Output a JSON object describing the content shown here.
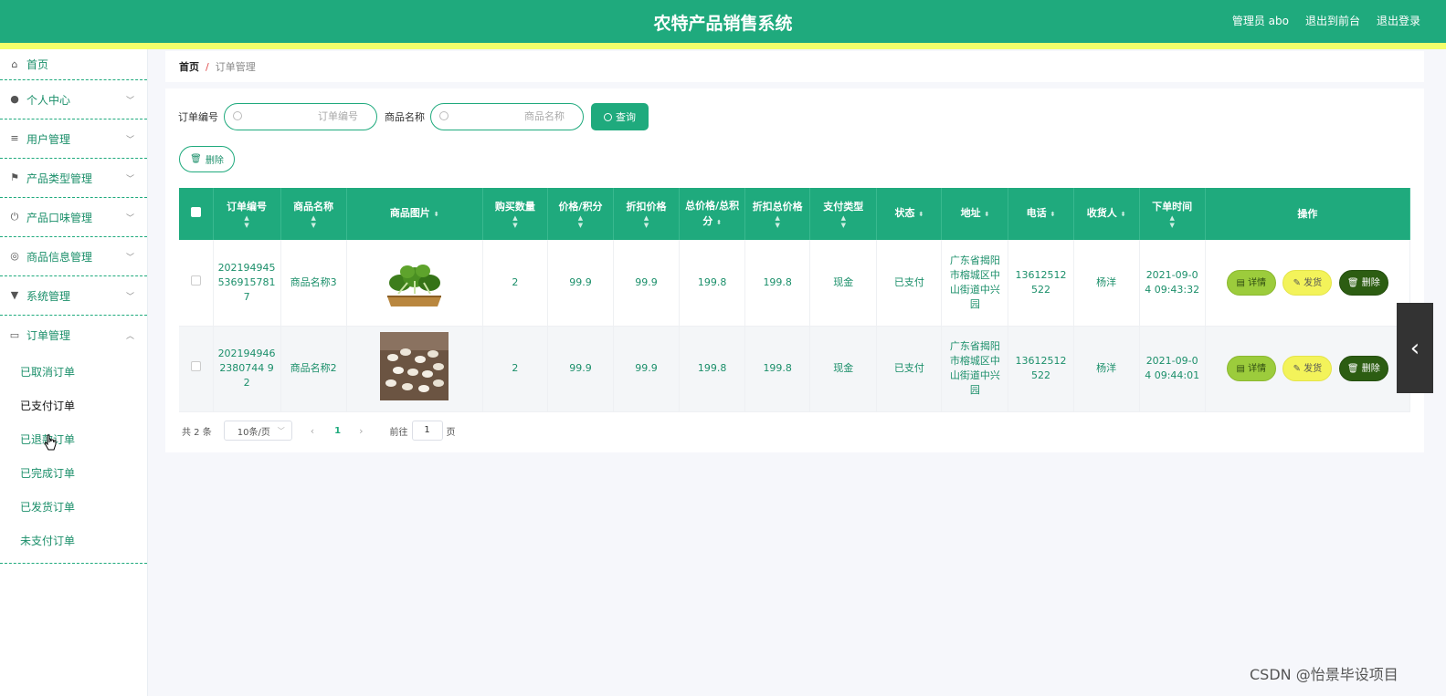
{
  "header": {
    "title": "农特产品销售系统",
    "admin": "管理员 abo",
    "to_front": "退出到前台",
    "logout": "退出登录"
  },
  "sidebar": {
    "items": [
      {
        "label": "首页",
        "icon": "home-icon"
      },
      {
        "label": "个人中心",
        "icon": "user-icon"
      },
      {
        "label": "用户管理",
        "icon": "list-icon"
      },
      {
        "label": "产品类型管理",
        "icon": "flag-icon"
      },
      {
        "label": "产品口味管理",
        "icon": "power-icon"
      },
      {
        "label": "商品信息管理",
        "icon": "compass-icon"
      },
      {
        "label": "系统管理",
        "icon": "pin-icon"
      },
      {
        "label": "订单管理",
        "icon": "card-icon"
      }
    ],
    "subitems": [
      "已取消订单",
      "已支付订单",
      "已退款订单",
      "已完成订单",
      "已发货订单",
      "未支付订单"
    ]
  },
  "breadcrumb": {
    "home": "首页",
    "sep": "/",
    "current": "订单管理"
  },
  "search": {
    "order_label": "订单编号",
    "order_placeholder": "订单编号",
    "name_label": "商品名称",
    "name_placeholder": "商品名称",
    "query": "查询"
  },
  "toolbar": {
    "delete": "删除"
  },
  "table": {
    "headers": [
      "订单编号",
      "商品名称",
      "商品图片",
      "购买数量",
      "价格/积分",
      "折扣价格",
      "总价格/总积分",
      "折扣总价格",
      "支付类型",
      "状态",
      "地址",
      "电话",
      "收货人",
      "下单时间",
      "操作"
    ],
    "rows": [
      {
        "order_no": "2021949455369157817",
        "name": "商品名称3",
        "image": "leafy-vegetable-image",
        "qty": "2",
        "price": "99.9",
        "discount": "99.9",
        "total": "199.8",
        "discount_total": "199.8",
        "pay_type": "现金",
        "status": "已支付",
        "address": "广东省揭阳市榕城区中山街道中兴园",
        "phone": "13612512522",
        "receiver": "杨洋",
        "time": "2021-09-04 09:43:32"
      },
      {
        "order_no": "2021949462380744 92",
        "name": "商品名称2",
        "image": "white-beans-image",
        "qty": "2",
        "price": "99.9",
        "discount": "99.9",
        "total": "199.8",
        "discount_total": "199.8",
        "pay_type": "现金",
        "status": "已支付",
        "address": "广东省揭阳市榕城区中山街道中兴园",
        "phone": "13612512522",
        "receiver": "杨洋",
        "time": "2021-09-04 09:44:01"
      }
    ],
    "actions": {
      "detail": "详情",
      "ship": "发货",
      "delete": "删除"
    }
  },
  "pager": {
    "total": "共 2 条",
    "page_size": "10条/页",
    "current": "1",
    "goto": "前往",
    "goto_value": "1",
    "page_unit": "页"
  },
  "watermark": "CSDN @怡景毕设项目",
  "colors": {
    "primary": "#1faa7d",
    "stripe": "#f3ff6a",
    "detail": "#9ccc3c",
    "ship": "#f3f35a",
    "delete": "#2c5d12"
  }
}
